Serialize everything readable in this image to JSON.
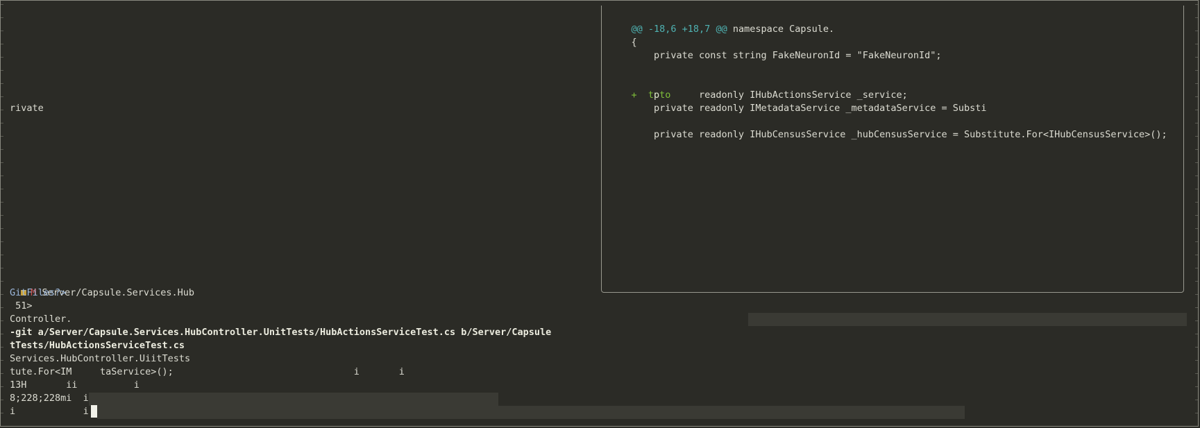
{
  "left": {
    "rivate": "rivate",
    "status_badge": "M",
    "status_path": "Server/Capsule.Services.Hub",
    "gitfiles": "GitFiles?>",
    "count": " 51>",
    "controller": "Controller.",
    "diff_header_1": "-git a/Server/Capsule.Services.HubController.UnitTests/HubActionsServiceTest.cs b/Server/Capsule",
    "diff_header_2": "tTests/HubActionsServiceTest.cs",
    "services": "Services.HubController.UiitTests",
    "tute": "tute.For<IM     taService>();                                i       i",
    "h13": "13H       ii          i",
    "esc": "8;228;228mi  i",
    "last": "i            i"
  },
  "popup": {
    "hunk_markers_open": "@@",
    "hunk_range": " -18,6 +18,7 ",
    "hunk_markers_close": "@@",
    "hunk_context": " namespace Capsule.",
    "brace": "    {",
    "line_fake": "        private const string FakeNeuronId = \"FakeNeuronId\";",
    "added_marker": "+",
    "added_text": "  toto",
    "line_p": "        p       readonly IHubActionsService _service;",
    "line_metadata": "        private readonly IMetadataService _metadataService = Substi",
    "line_census": "        private readonly IHubCensusService _hubCensusService = Substitute.For<IHubCensusService>();"
  }
}
